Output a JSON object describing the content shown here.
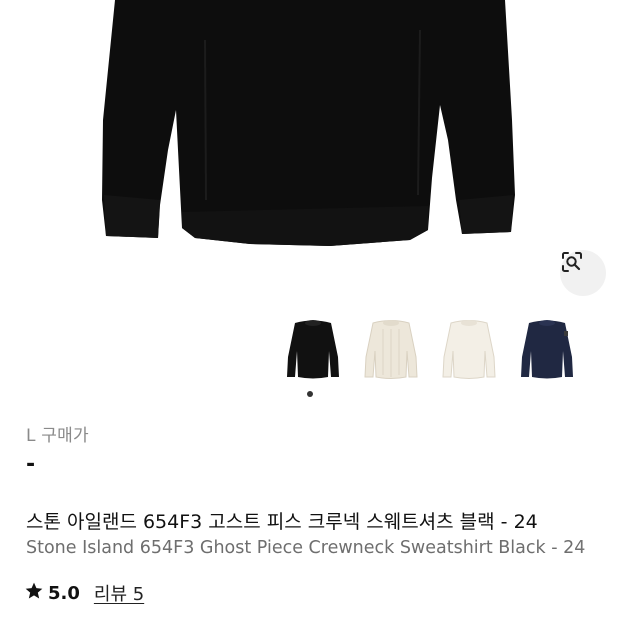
{
  "product": {
    "size_label": "L 구매가",
    "price": "-",
    "title_ko": "스톤 아일랜드 654F3 고스트 피스 크루넥 스웨트셔츠 블랙 - 24",
    "title_en": "Stone Island 654F3 Ghost Piece Crewneck Sweatshirt Black - 24",
    "rating": "5.0",
    "reviews_label": "리뷰 5"
  },
  "gallery": {
    "thumbnails": [
      {
        "name": "black-sweatshirt",
        "color": "#111111"
      },
      {
        "name": "ivory-sweatshirt",
        "color": "#ede7da"
      },
      {
        "name": "cream-sweatshirt",
        "color": "#f3efe6"
      },
      {
        "name": "navy-sweatshirt",
        "color": "#202842"
      }
    ],
    "active_index": 0
  },
  "icons": {
    "lens": "lens-search-icon",
    "star": "star-icon"
  }
}
